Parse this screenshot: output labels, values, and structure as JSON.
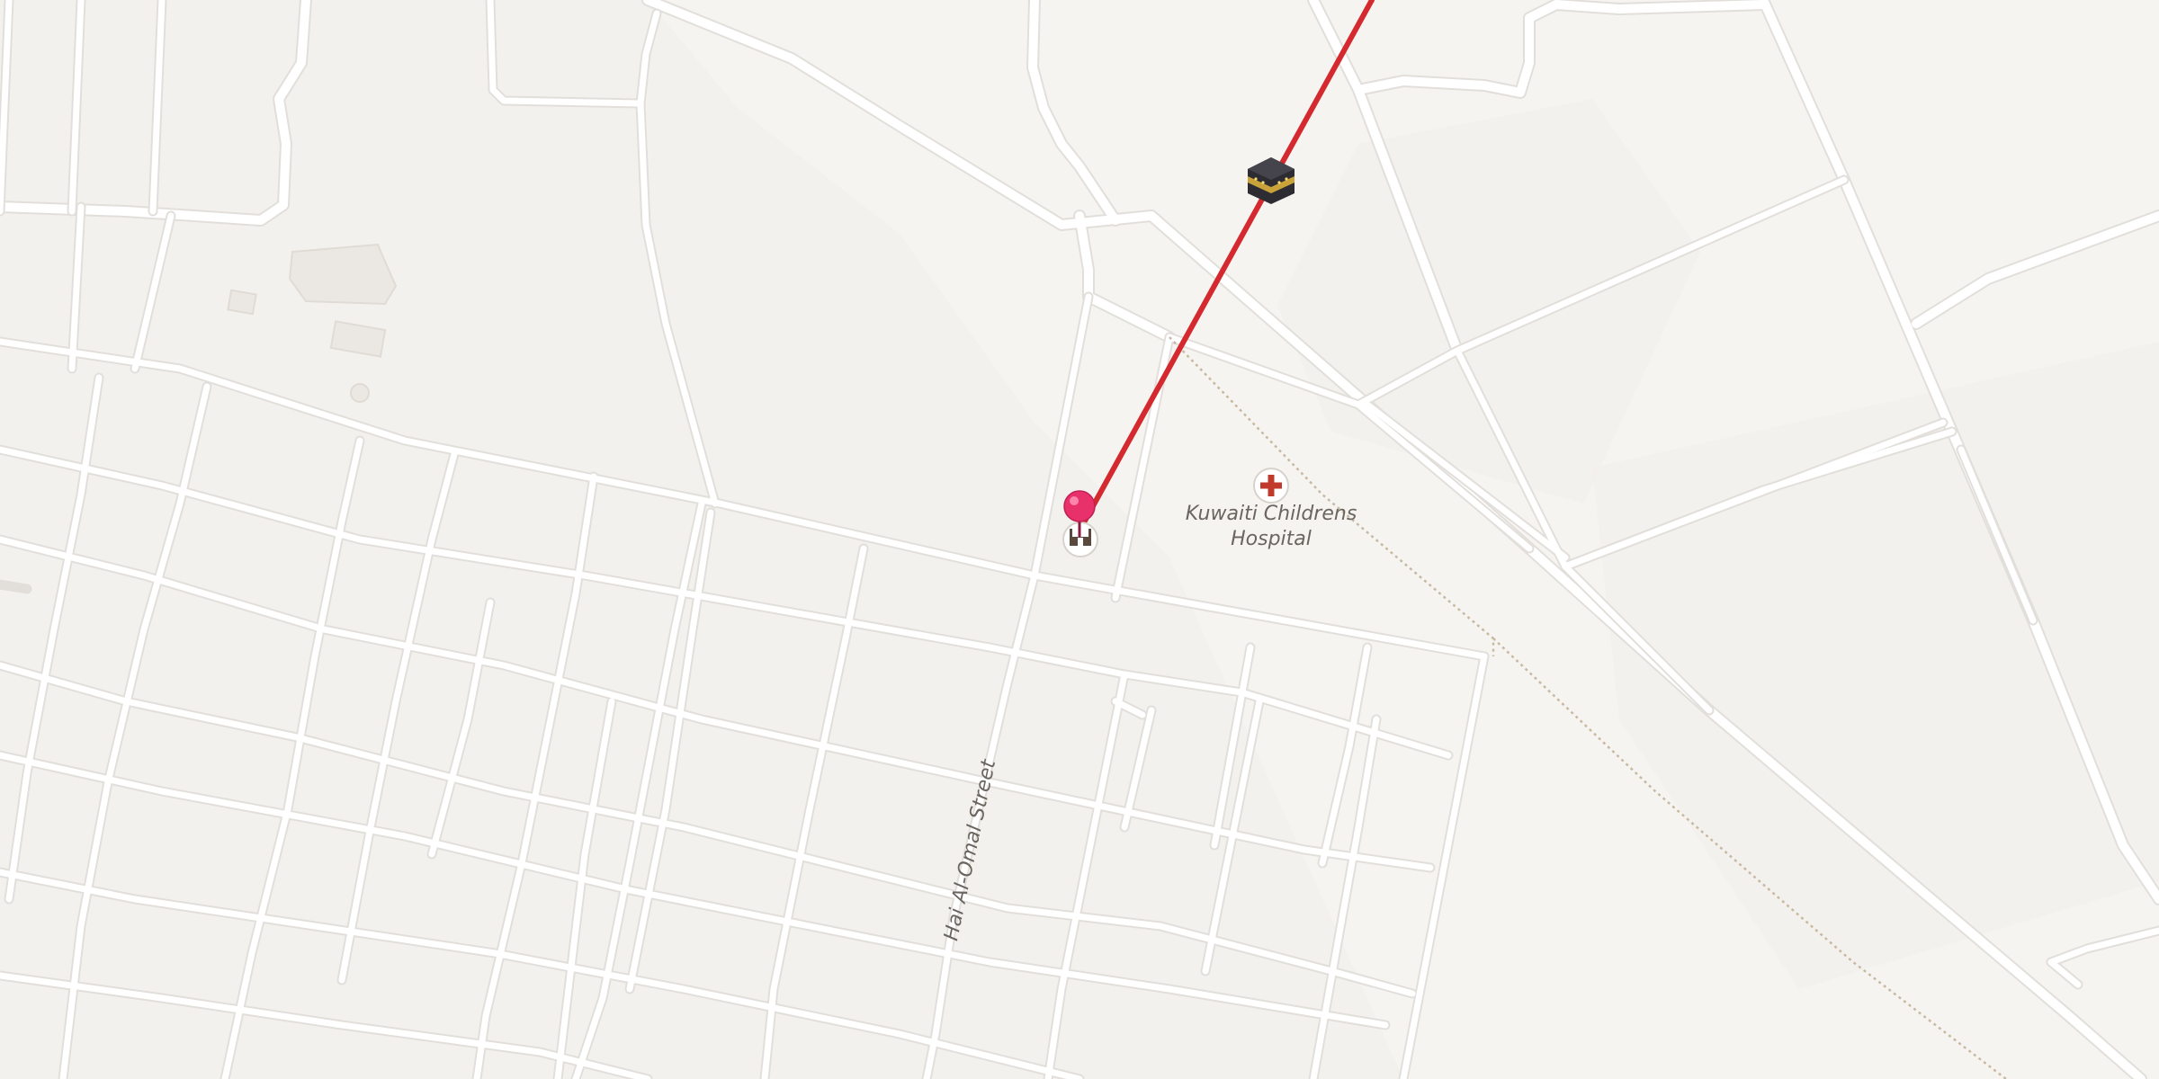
{
  "map": {
    "labels": {
      "hospital_line1": "Kuwaiti Childrens",
      "hospital_line2": "Hospital",
      "street": "Hai Al-Omal Street"
    },
    "icons": {
      "hospital": "hospital-cross-icon",
      "mosque": "mosque-icon",
      "kaaba": "kaaba-icon",
      "pin": "location-pin-icon"
    },
    "colors": {
      "background": "#f3f1ee",
      "road": "#ffffff",
      "qibla_line": "#d42a2f",
      "pin": "#e8316b",
      "hospital_cross": "#c0392b",
      "label_text": "#6b6560"
    }
  }
}
